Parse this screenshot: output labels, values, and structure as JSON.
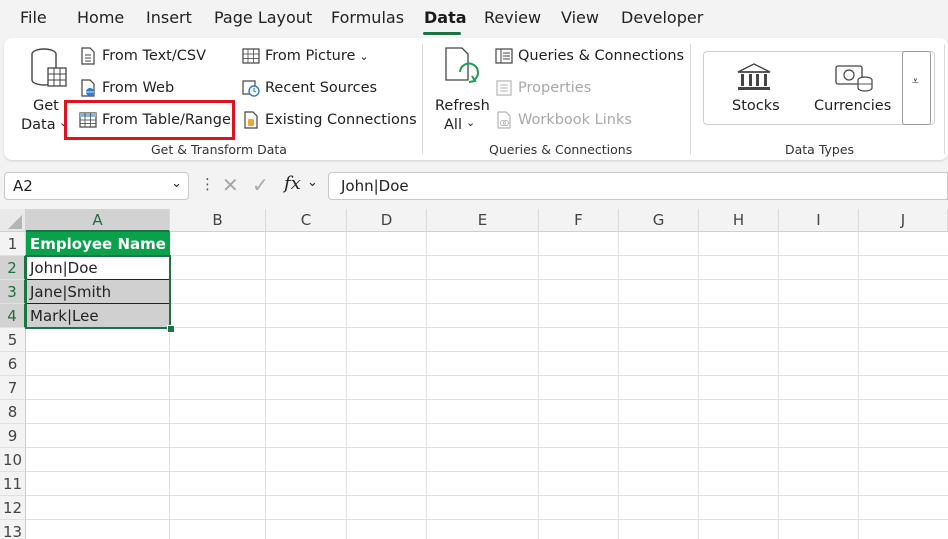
{
  "menu": {
    "items": [
      "File",
      "Home",
      "Insert",
      "Page Layout",
      "Formulas",
      "Data",
      "Review",
      "View",
      "Developer"
    ],
    "active": "Data"
  },
  "ribbon": {
    "get_data": {
      "line1": "Get",
      "line2": "Data"
    },
    "get_transform": {
      "from_text_csv": "From Text/CSV",
      "from_web": "From Web",
      "from_table_range": "From Table/Range",
      "from_picture": "From Picture",
      "recent_sources": "Recent Sources",
      "existing_connections": "Existing Connections",
      "label": "Get & Transform Data"
    },
    "queries": {
      "refresh_line1": "Refresh",
      "refresh_line2": "All",
      "queries_connections": "Queries & Connections",
      "properties": "Properties",
      "workbook_links": "Workbook Links",
      "label": "Queries & Connections"
    },
    "data_types": {
      "stocks": "Stocks",
      "currencies": "Currencies",
      "label": "Data Types"
    }
  },
  "formula_bar": {
    "name_box": "A2",
    "fx": "fx",
    "content": "John|Doe"
  },
  "sheet": {
    "columns": [
      "A",
      "B",
      "C",
      "D",
      "E",
      "F",
      "G",
      "H",
      "I",
      "J"
    ],
    "rows": [
      "1",
      "2",
      "3",
      "4",
      "5",
      "6",
      "7",
      "8",
      "9",
      "10",
      "11",
      "12",
      "13"
    ],
    "header_cell": "Employee Name",
    "values": [
      "John|Doe",
      "Jane|Smith",
      "Mark|Lee"
    ]
  },
  "colors": {
    "header_fill": "#0aa14b",
    "band_fill": "#d0d0d0",
    "selection": "#1f7244",
    "highlight_box": "#e0141e"
  }
}
